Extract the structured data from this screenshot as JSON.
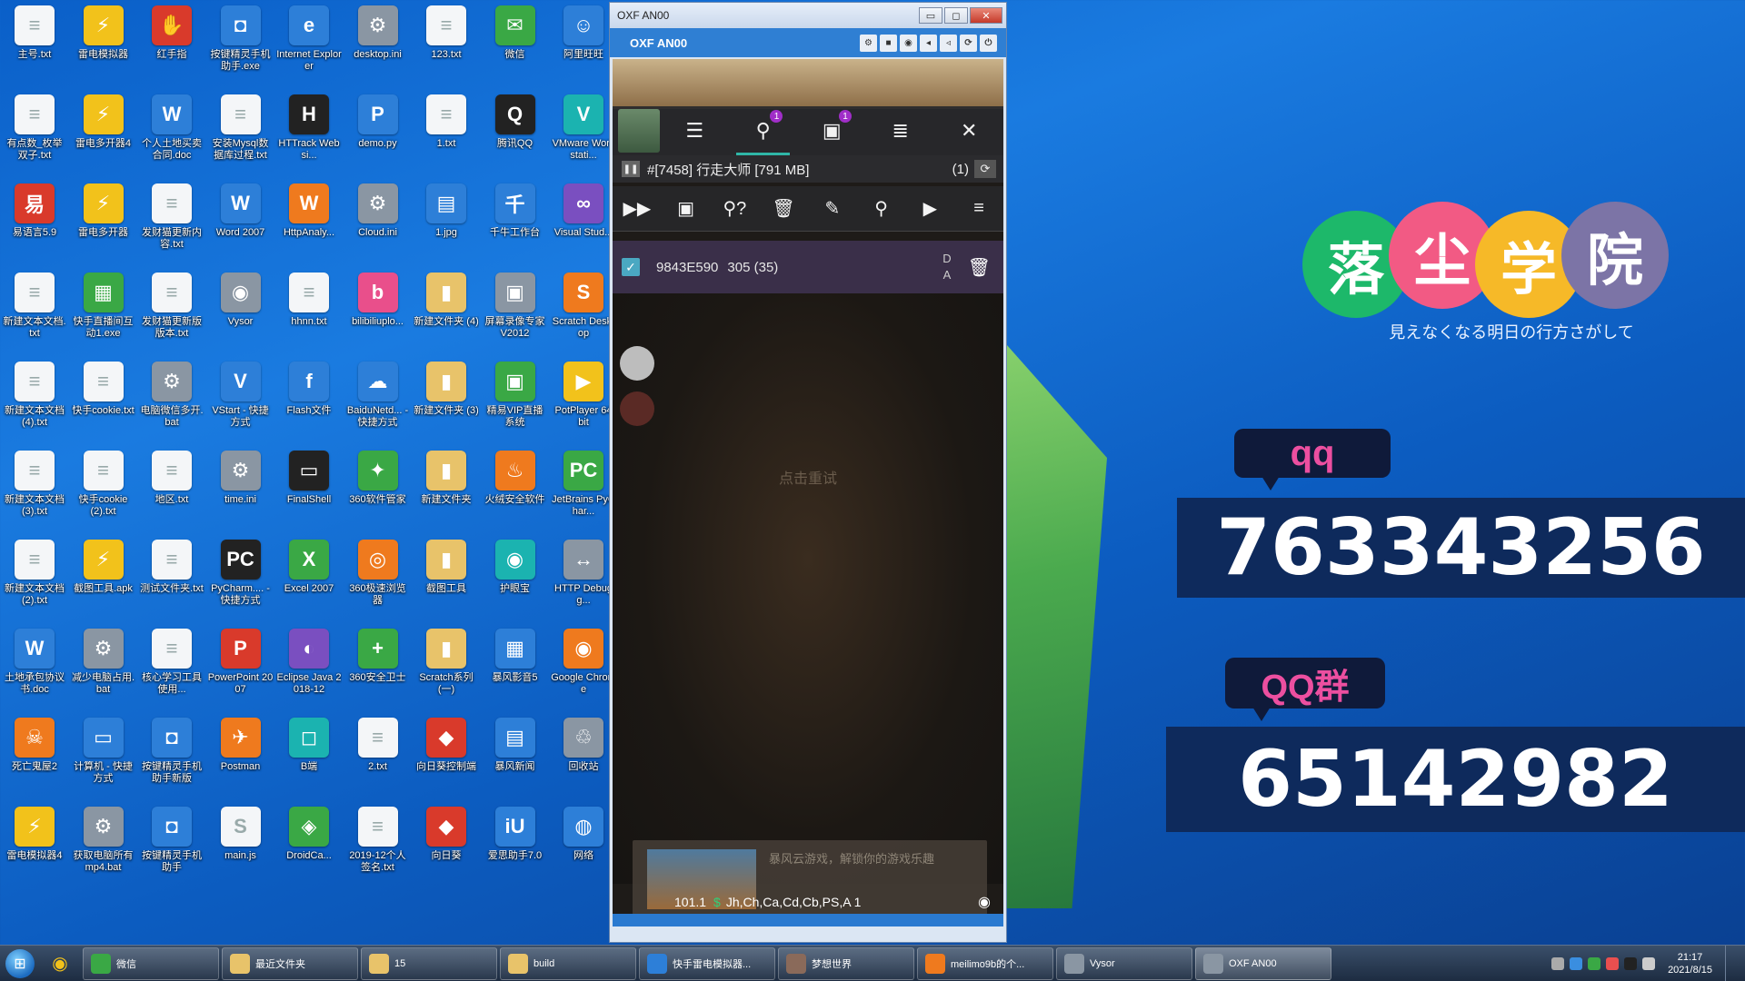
{
  "desktop_icons": [
    {
      "label": "主号.txt",
      "glyph": "≡",
      "color": "doc"
    },
    {
      "label": "雷电模拟器",
      "glyph": "⚡",
      "color": "yel"
    },
    {
      "label": "红手指",
      "glyph": "✋",
      "color": "red"
    },
    {
      "label": "按键精灵手机助手.exe",
      "glyph": "◘",
      "color": "blu"
    },
    {
      "label": "Internet Explorer",
      "glyph": "e",
      "color": "blu"
    },
    {
      "label": "desktop.ini",
      "glyph": "⚙",
      "color": "gry"
    },
    {
      "label": "123.txt",
      "glyph": "≡",
      "color": "doc"
    },
    {
      "label": "微信",
      "glyph": "✉",
      "color": "grn"
    },
    {
      "label": "阿里旺旺",
      "glyph": "☺",
      "color": "blu"
    },
    {
      "label": "有点数_枚举双子.txt",
      "glyph": "≡",
      "color": "doc"
    },
    {
      "label": "雷电多开器4",
      "glyph": "⚡",
      "color": "yel"
    },
    {
      "label": "个人土地买卖合同.doc",
      "glyph": "W",
      "color": "blu"
    },
    {
      "label": "安装Mysql数据库过程.txt",
      "glyph": "≡",
      "color": "doc"
    },
    {
      "label": "HTTrack Websi...",
      "glyph": "H",
      "color": "blk"
    },
    {
      "label": "demo.py",
      "glyph": "P",
      "color": "blu"
    },
    {
      "label": "1.txt",
      "glyph": "≡",
      "color": "doc"
    },
    {
      "label": "腾讯QQ",
      "glyph": "Q",
      "color": "blk"
    },
    {
      "label": "VMware Workstati...",
      "glyph": "V",
      "color": "tel"
    },
    {
      "label": "易语言5.9",
      "glyph": "易",
      "color": "red"
    },
    {
      "label": "雷电多开器",
      "glyph": "⚡",
      "color": "yel"
    },
    {
      "label": "发财猫更新内容.txt",
      "glyph": "≡",
      "color": "doc"
    },
    {
      "label": "Word 2007",
      "glyph": "W",
      "color": "blu"
    },
    {
      "label": "HttpAnaly...",
      "glyph": "W",
      "color": "org"
    },
    {
      "label": "Cloud.ini",
      "glyph": "⚙",
      "color": "gry"
    },
    {
      "label": "1.jpg",
      "glyph": "▤",
      "color": "blu"
    },
    {
      "label": "千牛工作台",
      "glyph": "千",
      "color": "blu"
    },
    {
      "label": "Visual Stud...",
      "glyph": "∞",
      "color": "pur"
    },
    {
      "label": "新建文本文档.txt",
      "glyph": "≡",
      "color": "doc"
    },
    {
      "label": "快手直播间互动1.exe",
      "glyph": "▦",
      "color": "grn"
    },
    {
      "label": "发财猫更新版版本.txt",
      "glyph": "≡",
      "color": "doc"
    },
    {
      "label": "Vysor",
      "glyph": "◉",
      "color": "gry"
    },
    {
      "label": "hhnn.txt",
      "glyph": "≡",
      "color": "doc"
    },
    {
      "label": "bilibiliuplo...",
      "glyph": "b",
      "color": "pnk"
    },
    {
      "label": "新建文件夹 (4)",
      "glyph": "▮",
      "color": "fld"
    },
    {
      "label": "屏幕录像专家V2012",
      "glyph": "▣",
      "color": "gry"
    },
    {
      "label": "Scratch Desktop",
      "glyph": "S",
      "color": "org"
    },
    {
      "label": "新建文本文档 (4).txt",
      "glyph": "≡",
      "color": "doc"
    },
    {
      "label": "快手cookie.txt",
      "glyph": "≡",
      "color": "doc"
    },
    {
      "label": "电脑微信多开.bat",
      "glyph": "⚙",
      "color": "gry"
    },
    {
      "label": "VStart - 快捷方式",
      "glyph": "V",
      "color": "blu"
    },
    {
      "label": "Flash文件",
      "glyph": "f",
      "color": "blu"
    },
    {
      "label": "BaiduNetd... - 快捷方式",
      "glyph": "☁",
      "color": "blu"
    },
    {
      "label": "新建文件夹 (3)",
      "glyph": "▮",
      "color": "fld"
    },
    {
      "label": "精易VIP直播系统",
      "glyph": "▣",
      "color": "grn"
    },
    {
      "label": "PotPlayer 64 bit",
      "glyph": "▶",
      "color": "yel"
    },
    {
      "label": "新建文本文档 (3).txt",
      "glyph": "≡",
      "color": "doc"
    },
    {
      "label": "快手cookie (2).txt",
      "glyph": "≡",
      "color": "doc"
    },
    {
      "label": "地区.txt",
      "glyph": "≡",
      "color": "doc"
    },
    {
      "label": "time.ini",
      "glyph": "⚙",
      "color": "gry"
    },
    {
      "label": "FinalShell",
      "glyph": "▭",
      "color": "blk"
    },
    {
      "label": "360软件管家",
      "glyph": "✦",
      "color": "grn"
    },
    {
      "label": "新建文件夹",
      "glyph": "▮",
      "color": "fld"
    },
    {
      "label": "火绒安全软件",
      "glyph": "♨",
      "color": "org"
    },
    {
      "label": "JetBrains PyChar...",
      "glyph": "PC",
      "color": "grn"
    },
    {
      "label": "新建文本文档 (2).txt",
      "glyph": "≡",
      "color": "doc"
    },
    {
      "label": "截图工具.apk",
      "glyph": "⚡",
      "color": "yel"
    },
    {
      "label": "测试文件夹.txt",
      "glyph": "≡",
      "color": "doc"
    },
    {
      "label": "PyCharm.... - 快捷方式",
      "glyph": "PC",
      "color": "blk"
    },
    {
      "label": "Excel 2007",
      "glyph": "X",
      "color": "grn"
    },
    {
      "label": "360极速浏览器",
      "glyph": "◎",
      "color": "org"
    },
    {
      "label": "截图工具",
      "glyph": "▮",
      "color": "fld"
    },
    {
      "label": "护眼宝",
      "glyph": "◉",
      "color": "tel"
    },
    {
      "label": "HTTP Debugg...",
      "glyph": "↔",
      "color": "gry"
    },
    {
      "label": "土地承包协议书.doc",
      "glyph": "W",
      "color": "blu"
    },
    {
      "label": "减少电脑占用.bat",
      "glyph": "⚙",
      "color": "gry"
    },
    {
      "label": "核心学习工具使用...",
      "glyph": "≡",
      "color": "doc"
    },
    {
      "label": "PowerPoint 2007",
      "glyph": "P",
      "color": "red"
    },
    {
      "label": "Eclipse Java 2018-12",
      "glyph": "◐",
      "color": "pur"
    },
    {
      "label": "360安全卫士",
      "glyph": "+",
      "color": "grn"
    },
    {
      "label": "Scratch系列 (一)",
      "glyph": "▮",
      "color": "fld"
    },
    {
      "label": "暴风影音5",
      "glyph": "▦",
      "color": "blu"
    },
    {
      "label": "Google Chrome",
      "glyph": "◉",
      "color": "org"
    },
    {
      "label": "死亡鬼屋2",
      "glyph": "☠",
      "color": "org"
    },
    {
      "label": "计算机 - 快捷方式",
      "glyph": "▭",
      "color": "blu"
    },
    {
      "label": "按键精灵手机助手新版",
      "glyph": "◘",
      "color": "blu"
    },
    {
      "label": "Postman",
      "glyph": "✈",
      "color": "org"
    },
    {
      "label": "B端",
      "glyph": "◻",
      "color": "tel"
    },
    {
      "label": "2.txt",
      "glyph": "≡",
      "color": "doc"
    },
    {
      "label": "向日葵控制端",
      "glyph": "◆",
      "color": "red"
    },
    {
      "label": "暴风新闻",
      "glyph": "▤",
      "color": "blu"
    },
    {
      "label": "回收站",
      "glyph": "♲",
      "color": "gry"
    },
    {
      "label": "雷电模拟器4",
      "glyph": "⚡",
      "color": "yel"
    },
    {
      "label": "获取电脑所有mp4.bat",
      "glyph": "⚙",
      "color": "gry"
    },
    {
      "label": "按键精灵手机助手",
      "glyph": "◘",
      "color": "blu"
    },
    {
      "label": "main.js",
      "glyph": "S",
      "color": "doc"
    },
    {
      "label": "DroidCa...",
      "glyph": "◈",
      "color": "grn"
    },
    {
      "label": "2019-12个人签名.txt",
      "glyph": "≡",
      "color": "doc"
    },
    {
      "label": "向日葵",
      "glyph": "◆",
      "color": "red"
    },
    {
      "label": "爱思助手7.0",
      "glyph": "iU",
      "color": "blu"
    },
    {
      "label": "网络",
      "glyph": "◍",
      "color": "blu"
    }
  ],
  "emulator": {
    "window_title": "OXF AN00",
    "toolbar_title": "OXF AN00",
    "minimize": "▭",
    "maximize": "◻",
    "close": "✕",
    "toolbar_icons": [
      "gear-icon",
      "video-icon",
      "camera-icon",
      "volume-down-icon",
      "volume-up-icon",
      "rotate-icon",
      "power-icon"
    ],
    "toolbar_glyphs": [
      "⚙",
      "■",
      "◉",
      "◂",
      "◃",
      "⟳",
      "⏻"
    ],
    "overlay": {
      "search_badge": "1",
      "save_badge": "1",
      "icons": [
        "sliders-icon",
        "search-icon",
        "save-icon",
        "list-icon",
        "close-icon"
      ],
      "glyphs": [
        "☰",
        "⚲",
        "▣",
        "≣",
        "✕"
      ]
    },
    "process": {
      "label": "#[7458] 行走大师 [791 MB]",
      "count": "(1)"
    },
    "actions": {
      "glyphs": [
        "▶▶",
        "▣",
        "⚲?",
        "🗑",
        "✎",
        "⚲",
        "▶",
        "≡"
      ],
      "names": [
        "fast-forward-icon",
        "save-icon",
        "search-unknown-icon",
        "delete-icon",
        "edit-icon",
        "search-icon",
        "play-icon",
        "menu-icon"
      ]
    },
    "result": {
      "address": "9843E590",
      "value": "305 (35)",
      "type_top": "D",
      "type_bottom": "A",
      "checked": "✓",
      "delete": "🗑"
    },
    "retry_text": "点击重试",
    "banner_text": "暴风云游戏，解锁你的游戏乐趣",
    "status": {
      "version": "101.1",
      "dollar": "$",
      "regs": "Jh,Ch,Ca,Cd,Cb,PS,A 1",
      "eye": "◉"
    }
  },
  "promo": {
    "logo_chars": [
      "落",
      "尘",
      "学",
      "院"
    ],
    "logo_colors": [
      "#1db86a",
      "#f25a84",
      "#f6b928",
      "#7c74a6"
    ],
    "subtitle": "見えなくなる明日の行方さがして",
    "qq_label": "qq",
    "qq_number": "763343256",
    "group_label": "QQ群",
    "group_number": "65142982"
  },
  "taskbar": {
    "start_icon": "windows-start-icon",
    "pinned": [
      {
        "name": "chrome-pin",
        "glyph": "◉"
      }
    ],
    "tasks": [
      {
        "label": "微信",
        "color": "#3aa845",
        "active": false
      },
      {
        "label": "最近文件夹",
        "color": "#e8c36a",
        "active": false
      },
      {
        "label": "15",
        "color": "#e8c36a",
        "active": false
      },
      {
        "label": "build",
        "color": "#e8c36a",
        "active": false
      },
      {
        "label": "快手雷电模拟器...",
        "color": "#2d7fd8",
        "active": false
      },
      {
        "label": "梦想世界",
        "color": "#8a6a5a",
        "active": false
      },
      {
        "label": "meilimo9b的个...",
        "color": "#ef7a1e",
        "active": false
      },
      {
        "label": "Vysor",
        "color": "#8a96a3",
        "active": false
      },
      {
        "label": "OXF AN00",
        "color": "#8a96a3",
        "active": true
      }
    ],
    "clock_time": "21:17",
    "clock_date": "2021/8/15"
  }
}
